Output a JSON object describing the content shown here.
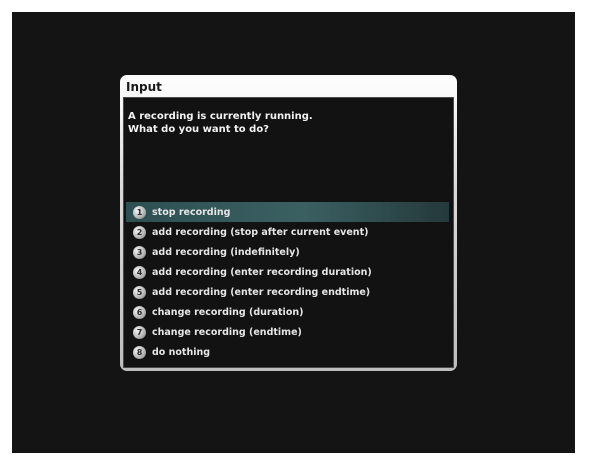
{
  "dialog": {
    "title": "Input",
    "message_line1": "A recording is currently running.",
    "message_line2": "What do you want to do?"
  },
  "choices": [
    {
      "number": "1",
      "label": "stop recording",
      "selected": true
    },
    {
      "number": "2",
      "label": "add recording (stop after current event)",
      "selected": false
    },
    {
      "number": "3",
      "label": "add recording (indefinitely)",
      "selected": false
    },
    {
      "number": "4",
      "label": "add recording (enter recording duration)",
      "selected": false
    },
    {
      "number": "5",
      "label": "add recording (enter recording endtime)",
      "selected": false
    },
    {
      "number": "6",
      "label": "change recording (duration)",
      "selected": false
    },
    {
      "number": "7",
      "label": "change recording (endtime)",
      "selected": false
    },
    {
      "number": "8",
      "label": "do nothing",
      "selected": false
    }
  ],
  "colors": {
    "background": "#141414",
    "highlight": "#3b6062",
    "text": "#e6e6e6"
  }
}
